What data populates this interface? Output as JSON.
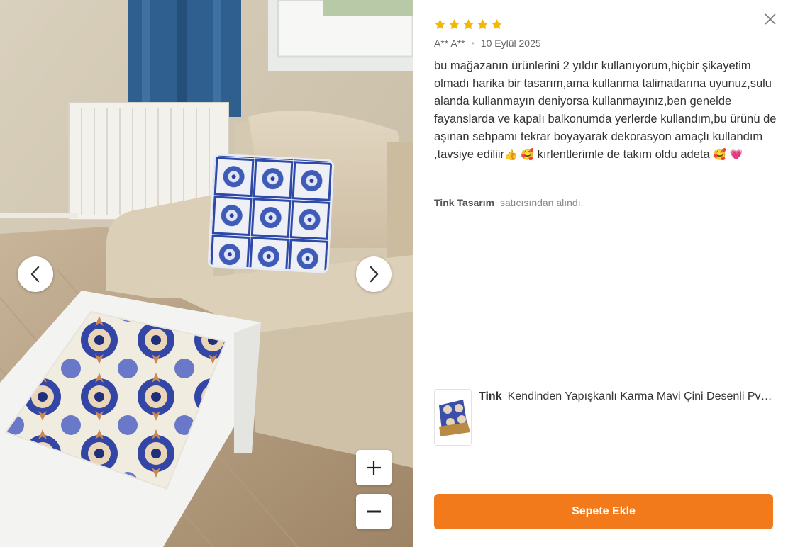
{
  "review": {
    "rating": 5,
    "author": "A** A**",
    "date": "10 Eylül 2025",
    "comment_text": "bu mağazanın ürünlerini 2 yıldır kullanıyorum,hiçbir şikayetim olmadı harika bir tasarım,ama kullanma talimatlarına uyunuz,sulu alanda kullanmayın deniyorsa kullanmayınız,ben genelde fayanslarda ve kapalı balkonumda yerlerde kullandım,bu ürünü de aşınan sehpamı tekrar boyayarak dekorasyon amaçlı kullandım ,tavsiye ediliir",
    "emoji_thumbs": "👍",
    "emoji_smile_hearts": "🥰",
    "comment_tail": "kırlentlerimle de takım oldu adeta",
    "emoji_end_smile": "🥰",
    "emoji_end_heart": "💗"
  },
  "seller": {
    "name": "Tink Tasarım",
    "suffix": "satıcısından alındı."
  },
  "product": {
    "brand": "Tink",
    "title": "Kendinden Yapışkanlı Karma Mavi Çini Desenli Pvc Karo Folyo"
  },
  "actions": {
    "add_to_cart": "Sepete Ekle"
  },
  "icons": {
    "close": "close-icon",
    "prev": "chevron-left-icon",
    "next": "chevron-right-icon",
    "zoom_in": "plus-icon",
    "zoom_out": "minus-icon",
    "star": "star-icon"
  },
  "colors": {
    "star": "#f5b800",
    "accent": "#f27a1a",
    "tile_blue": "#2a3f9a"
  }
}
